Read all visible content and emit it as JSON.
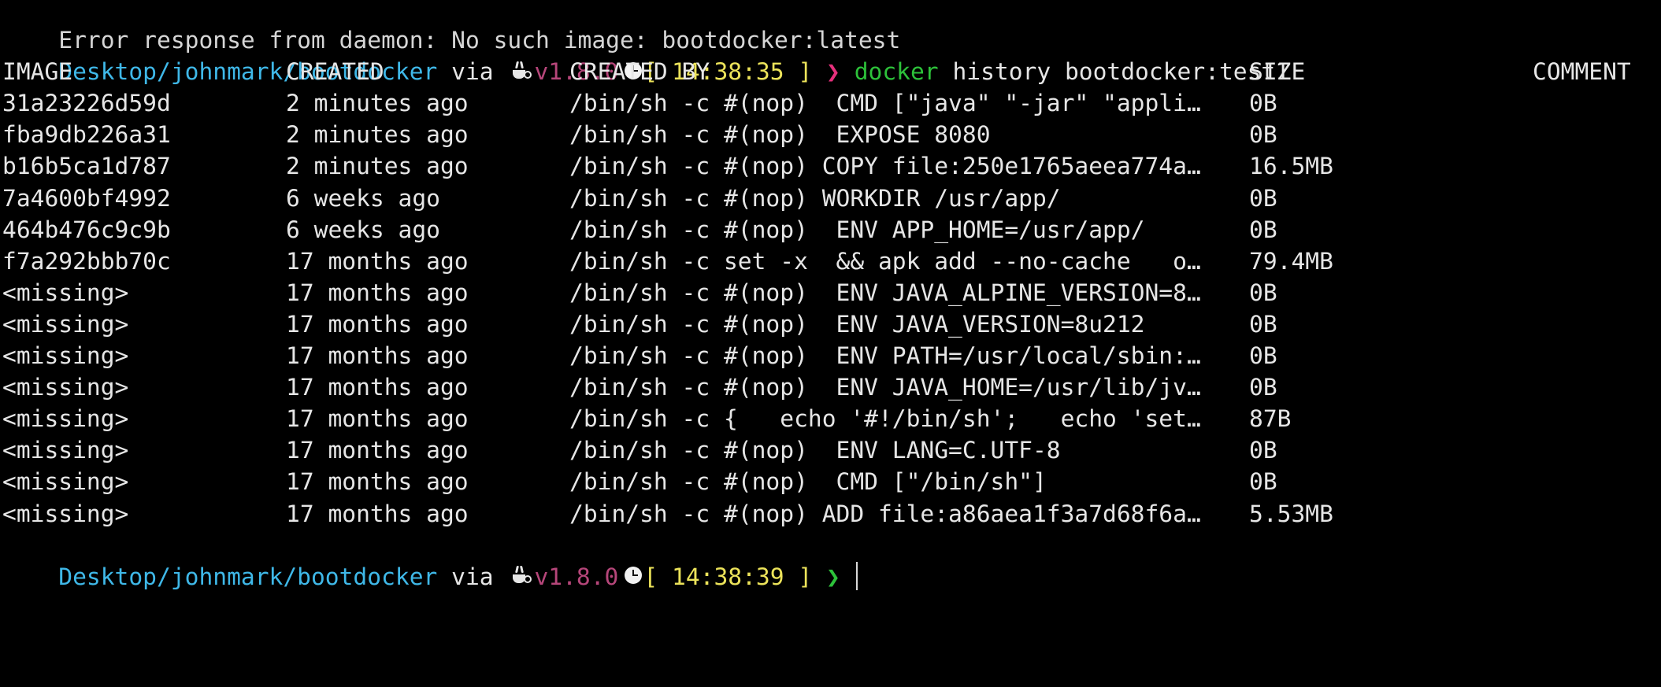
{
  "top_partial_line": "Error response from daemon: No such image: bootdocker:latest",
  "prompt1": {
    "path": "Desktop/johnmark/bootdocker",
    "via": "via",
    "version": "v1.8.0",
    "time_open": "[",
    "time": "14:38:35",
    "time_close": "]",
    "chevron": "❯",
    "command": "docker",
    "args": "history bootdocker:test1"
  },
  "table": {
    "headers": {
      "image": "IMAGE",
      "created": "CREATED",
      "created_by": "CREATED BY",
      "size": "SIZE",
      "comment": "COMMENT"
    },
    "rows": [
      {
        "image": "31a23226d59d",
        "created": "2 minutes ago",
        "created_by": "/bin/sh -c #(nop)  CMD [\"java\" \"-jar\" \"appli…",
        "size": "0B"
      },
      {
        "image": "fba9db226a31",
        "created": "2 minutes ago",
        "created_by": "/bin/sh -c #(nop)  EXPOSE 8080",
        "size": "0B"
      },
      {
        "image": "b16b5ca1d787",
        "created": "2 minutes ago",
        "created_by": "/bin/sh -c #(nop) COPY file:250e1765aeea774a…",
        "size": "16.5MB"
      },
      {
        "image": "7a4600bf4992",
        "created": "6 weeks ago",
        "created_by": "/bin/sh -c #(nop) WORKDIR /usr/app/",
        "size": "0B"
      },
      {
        "image": "464b476c9c9b",
        "created": "6 weeks ago",
        "created_by": "/bin/sh -c #(nop)  ENV APP_HOME=/usr/app/",
        "size": "0B"
      },
      {
        "image": "f7a292bbb70c",
        "created": "17 months ago",
        "created_by": "/bin/sh -c set -x  && apk add --no-cache   o…",
        "size": "79.4MB"
      },
      {
        "image": "<missing>",
        "created": "17 months ago",
        "created_by": "/bin/sh -c #(nop)  ENV JAVA_ALPINE_VERSION=8…",
        "size": "0B"
      },
      {
        "image": "<missing>",
        "created": "17 months ago",
        "created_by": "/bin/sh -c #(nop)  ENV JAVA_VERSION=8u212",
        "size": "0B"
      },
      {
        "image": "<missing>",
        "created": "17 months ago",
        "created_by": "/bin/sh -c #(nop)  ENV PATH=/usr/local/sbin:…",
        "size": "0B"
      },
      {
        "image": "<missing>",
        "created": "17 months ago",
        "created_by": "/bin/sh -c #(nop)  ENV JAVA_HOME=/usr/lib/jv…",
        "size": "0B"
      },
      {
        "image": "<missing>",
        "created": "17 months ago",
        "created_by": "/bin/sh -c {   echo '#!/bin/sh';   echo 'set…",
        "size": "87B"
      },
      {
        "image": "<missing>",
        "created": "17 months ago",
        "created_by": "/bin/sh -c #(nop)  ENV LANG=C.UTF-8",
        "size": "0B"
      },
      {
        "image": "<missing>",
        "created": "17 months ago",
        "created_by": "/bin/sh -c #(nop)  CMD [\"/bin/sh\"]",
        "size": "0B"
      },
      {
        "image": "<missing>",
        "created": "17 months ago",
        "created_by": "/bin/sh -c #(nop) ADD file:a86aea1f3a7d68f6a…",
        "size": "5.53MB"
      }
    ]
  },
  "prompt2": {
    "path": "Desktop/johnmark/bootdocker",
    "via": "via",
    "version": "v1.8.0",
    "time_open": "[",
    "time": "14:38:39",
    "time_close": "]",
    "chevron": "❯"
  },
  "icons": {
    "runtime": "coffee-icon",
    "clock": "clock-icon"
  },
  "colors": {
    "background": "#000000",
    "path": "#3fb8e8",
    "version": "#b6467a",
    "time": "#ece35a",
    "command": "#2dc23a",
    "chevron_error": "#e6307c",
    "chevron_ok": "#2dc23a",
    "text": "#e6e6e6"
  }
}
